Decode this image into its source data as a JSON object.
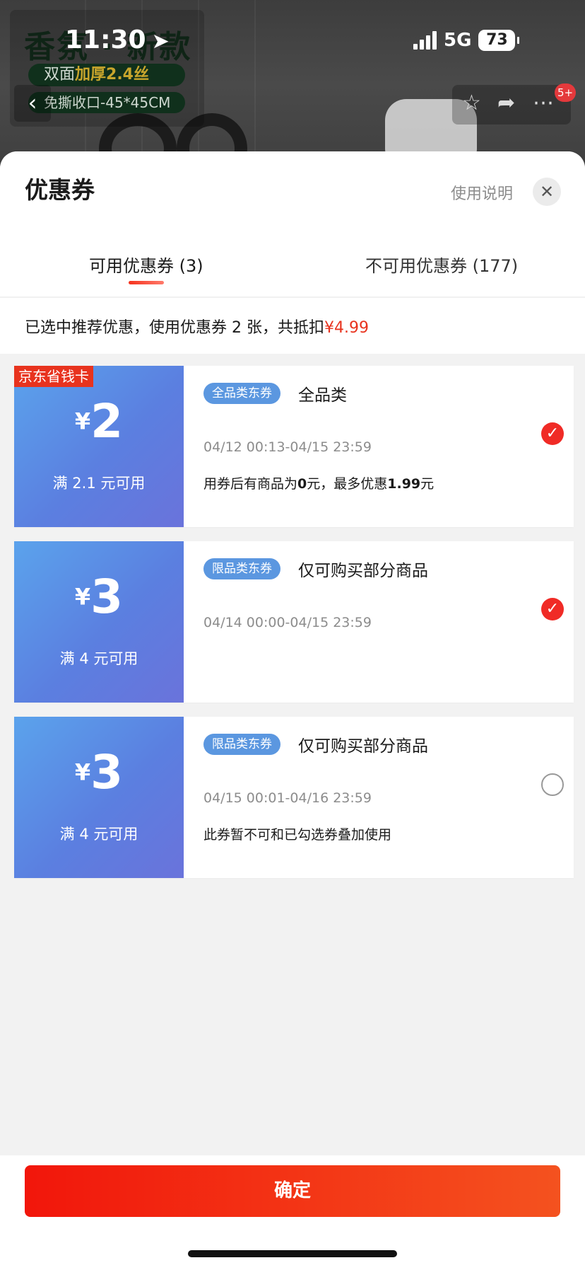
{
  "status_bar": {
    "time": "11:30",
    "network": "5G",
    "battery": "73"
  },
  "background_page": {
    "banner_title": "香氛 · 新款",
    "banner_pill1_prefix": "双面",
    "banner_pill1_highlight": "加厚2.4丝",
    "banner_pill2": "免撕收口-45*45CM",
    "cart_badge": "5+"
  },
  "sheet": {
    "title": "优惠券",
    "usage_link": "使用说明",
    "close_icon": "close-icon"
  },
  "tabs": {
    "available": "可用优惠券 (3)",
    "unavailable": "不可用优惠券 (177)"
  },
  "summary": {
    "text": "已选中推荐优惠，使用优惠券 2 张，共抵扣",
    "amount": "¥4.99"
  },
  "coupons": [
    {
      "tag": "京东省钱卡",
      "currency": "¥",
      "amount": "2",
      "condition": "满 2.1 元可用",
      "type": "全品类东券",
      "scope": "全品类",
      "validity": "04/12 00:13-04/15 23:59",
      "note_prefix": "用券后有商品为",
      "note_zero": "0",
      "note_mid": "元，最多优惠",
      "note_max": "1.99",
      "note_suffix": "元",
      "selected": true
    },
    {
      "currency": "¥",
      "amount": "3",
      "condition": "满 4 元可用",
      "type": "限品类东券",
      "scope": "仅可购买部分商品",
      "validity": "04/14 00:00-04/15 23:59",
      "selected": true
    },
    {
      "currency": "¥",
      "amount": "3",
      "condition": "满 4 元可用",
      "type": "限品类东券",
      "scope": "仅可购买部分商品",
      "validity": "04/15 00:01-04/16 23:59",
      "note": "此券暂不可和已勾选券叠加使用",
      "selected": false
    }
  ],
  "confirm_label": "确定",
  "colors": {
    "accent": "#e8331e",
    "coupon_blue": "#5b8ae4",
    "confirm_start": "#f2160b",
    "confirm_end": "#f4521f"
  }
}
